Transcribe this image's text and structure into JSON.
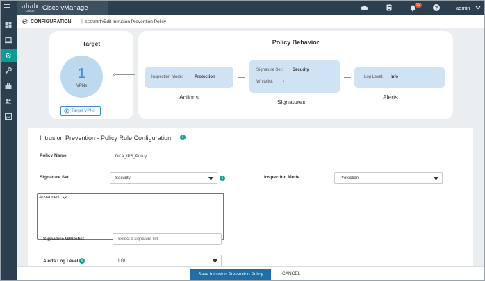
{
  "app": {
    "name": "Cisco vManage",
    "notification_count": "99",
    "user": "admin"
  },
  "topbar_icons": [
    "cloud-icon",
    "clipboard-icon",
    "bell-icon",
    "help-icon"
  ],
  "sidebar": {
    "items": [
      {
        "icon": "dashboard-icon",
        "active": false
      },
      {
        "icon": "monitor-icon",
        "active": false
      },
      {
        "icon": "gear-icon",
        "active": true
      },
      {
        "icon": "wrench-icon",
        "active": false
      },
      {
        "icon": "toolbox-icon",
        "active": false
      },
      {
        "icon": "users-icon",
        "active": false
      },
      {
        "icon": "analytics-icon",
        "active": false
      }
    ]
  },
  "breadcrumb": {
    "section": "CONFIGURATION",
    "subsection": "SECURITY",
    "page": "Edit Intrusion Prevention Policy"
  },
  "target": {
    "title": "Target",
    "vpn_count": "1",
    "vpn_label": "VPNs",
    "button_label": "Target VPNs"
  },
  "behavior": {
    "title": "Policy Behavior",
    "actions": {
      "label": "Inspection Mode:",
      "value": "Protection",
      "title": "Actions"
    },
    "signatures": {
      "set_label": "Signature Set:",
      "set_value": "Security",
      "whitelist_label": "Whitelist:",
      "whitelist_value": "-",
      "title": "Signatures"
    },
    "alerts": {
      "label": "Log Level:",
      "value": "Info",
      "title": "Alerts"
    }
  },
  "form": {
    "title": "Intrusion Prevention - Policy Rule Configuration",
    "policy_name_label": "Policy Name",
    "policy_name_value": "DCA_IPS_Policy",
    "signature_set_label": "Signature Set",
    "signature_set_value": "Security",
    "inspection_mode_label": "Inspection Mode",
    "inspection_mode_value": "Protection",
    "advanced_label": "Advanced",
    "whitelist_label": "Signature Whitelist",
    "whitelist_placeholder": "Select a signature list",
    "alerts_log_label": "Alerts Log Level",
    "alerts_log_value": "Info"
  },
  "footer": {
    "save_label": "Save Intrusion Prevention Policy",
    "cancel_label": "CANCEL"
  },
  "colors": {
    "topbar": "#2c3f4f",
    "active_nav": "#0e9c96",
    "accent_blue": "#1f6fa5",
    "highlight_border": "#d9512c"
  }
}
